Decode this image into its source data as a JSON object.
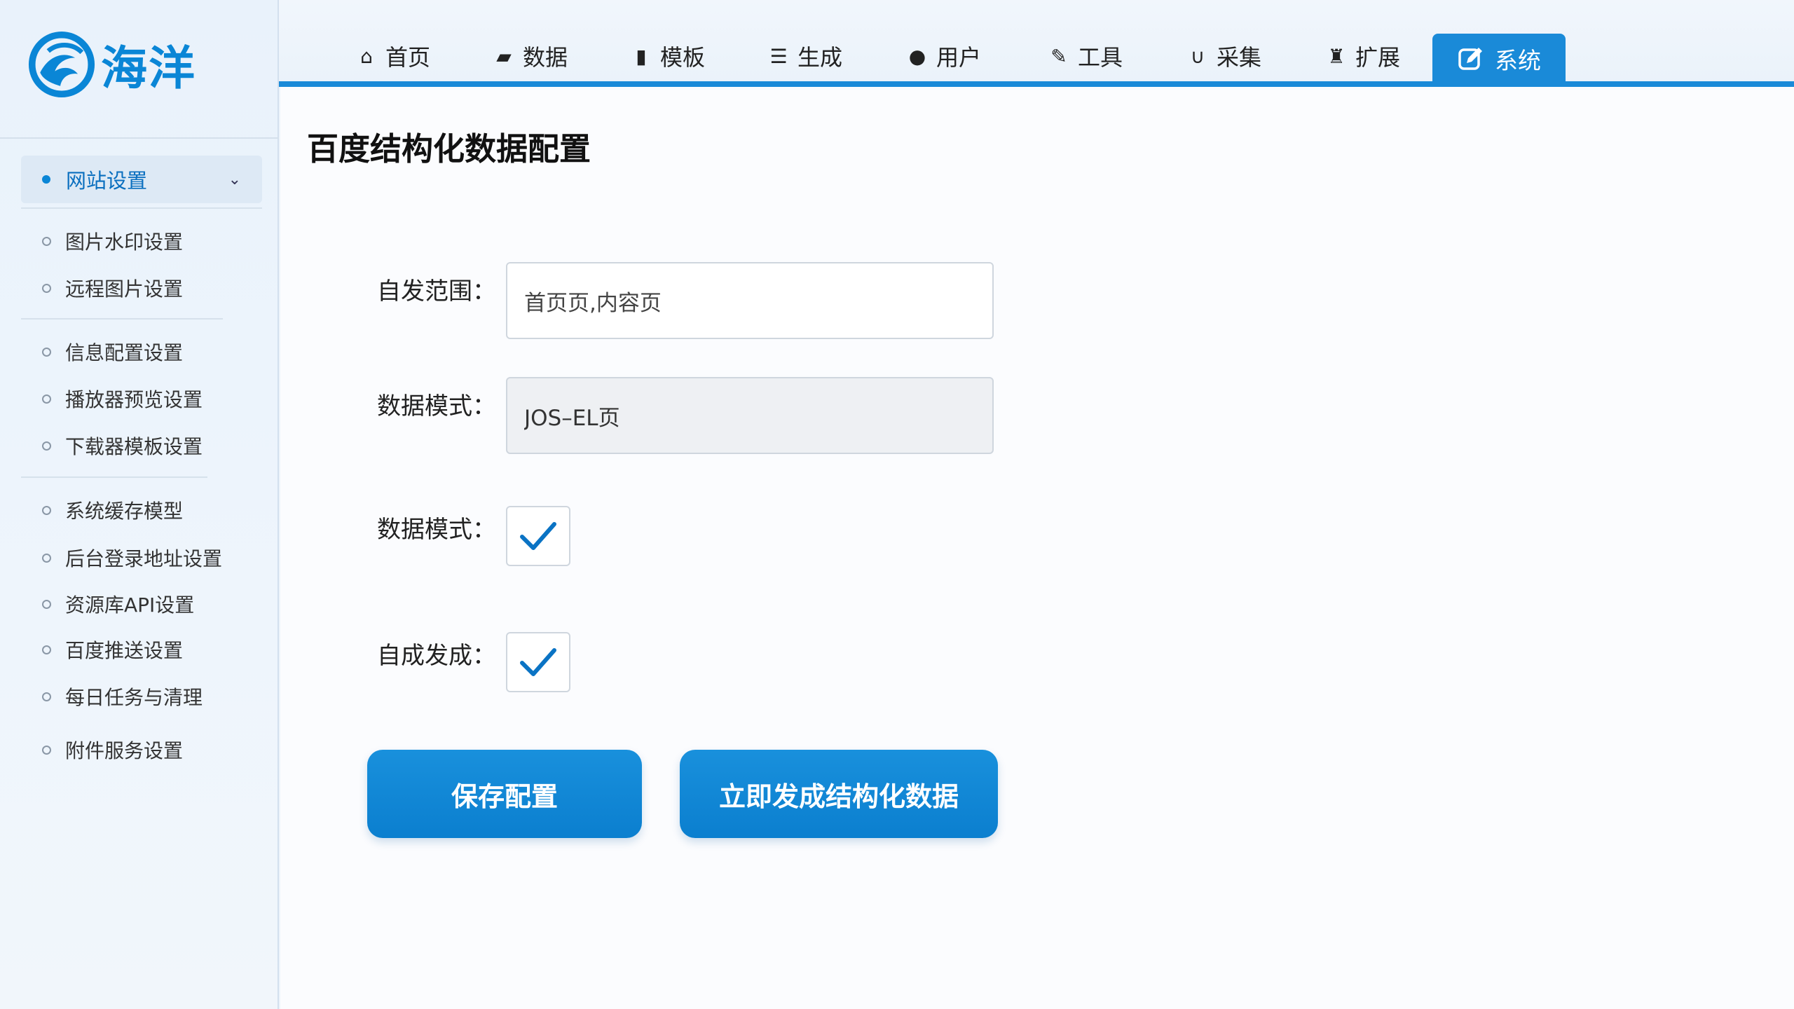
{
  "brand": {
    "name": "海洋",
    "color": "#0a86d6"
  },
  "topnav": {
    "items": [
      {
        "label": "首页",
        "icon": "home-icon"
      },
      {
        "label": "数据",
        "icon": "database-icon"
      },
      {
        "label": "模板",
        "icon": "file-icon"
      },
      {
        "label": "生成",
        "icon": "generate-icon"
      },
      {
        "label": "用户",
        "icon": "user-icon"
      },
      {
        "label": "工具",
        "icon": "wrench-icon"
      },
      {
        "label": "采集",
        "icon": "magnet-icon"
      },
      {
        "label": "扩展",
        "icon": "puzzle-icon"
      }
    ],
    "active": {
      "label": "系统",
      "icon": "edit-icon"
    },
    "accent": "#1a8ad8"
  },
  "sidebar": {
    "group": {
      "label": "网站设置"
    },
    "items": [
      {
        "label": "图片水印设置"
      },
      {
        "label": "远程图片设置"
      },
      {
        "label": "信息配置设置"
      },
      {
        "label": "播放器预览设置"
      },
      {
        "label": "下载器模板设置"
      },
      {
        "label": "系统缓存模型"
      },
      {
        "label": "后台登录地址设置"
      },
      {
        "label": "资源库API设置"
      },
      {
        "label": "百度推送设置"
      },
      {
        "label": "每日任务与清理"
      },
      {
        "label": "附件服务设置"
      }
    ]
  },
  "main": {
    "title": "百度结构化数据配置",
    "form": {
      "scope_label": "自发范围：",
      "scope_value": "首页页,内容页",
      "mode_label": "数据模式：",
      "mode_value": "JOS–EL页",
      "mode_check_label": "数据模式：",
      "mode_checked": true,
      "auto_label": "自成发成：",
      "auto_checked": true
    },
    "buttons": {
      "save": "保存配置",
      "generate": "立即发成结构化数据"
    }
  }
}
